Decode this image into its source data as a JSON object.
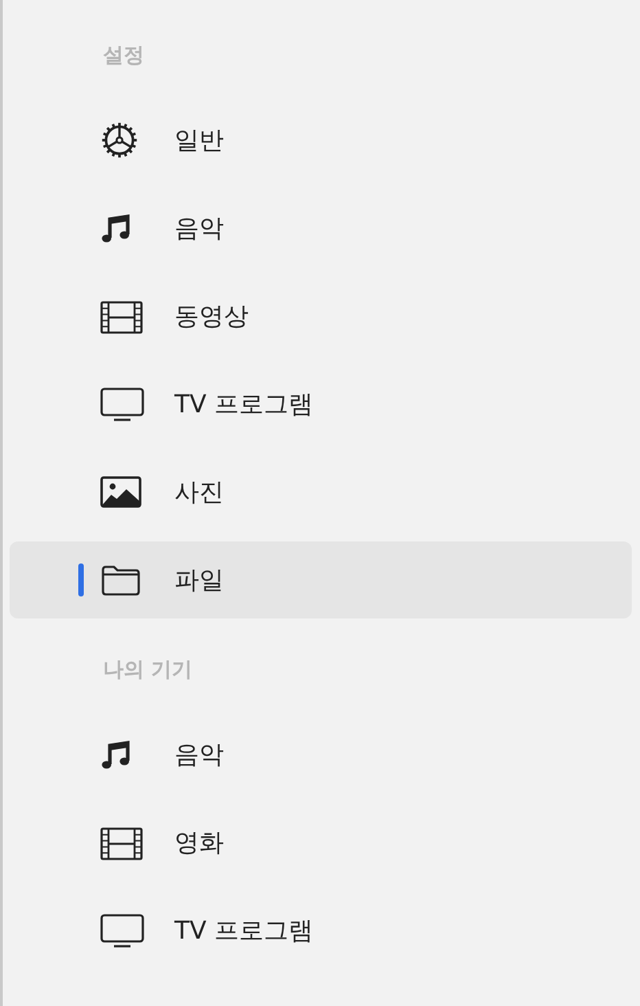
{
  "sections": [
    {
      "title": "설정",
      "items": [
        {
          "label": "일반",
          "kind": "gear",
          "selected": false
        },
        {
          "label": "음악",
          "kind": "music",
          "selected": false
        },
        {
          "label": "동영상",
          "kind": "film",
          "selected": false
        },
        {
          "label": "TV 프로그램",
          "kind": "tv",
          "selected": false
        },
        {
          "label": "사진",
          "kind": "photo",
          "selected": false
        },
        {
          "label": "파일",
          "kind": "folder",
          "selected": true
        }
      ]
    },
    {
      "title": "나의 기기",
      "items": [
        {
          "label": "음악",
          "kind": "music",
          "selected": false
        },
        {
          "label": "영화",
          "kind": "film",
          "selected": false
        },
        {
          "label": "TV 프로그램",
          "kind": "tv",
          "selected": false
        }
      ]
    }
  ]
}
